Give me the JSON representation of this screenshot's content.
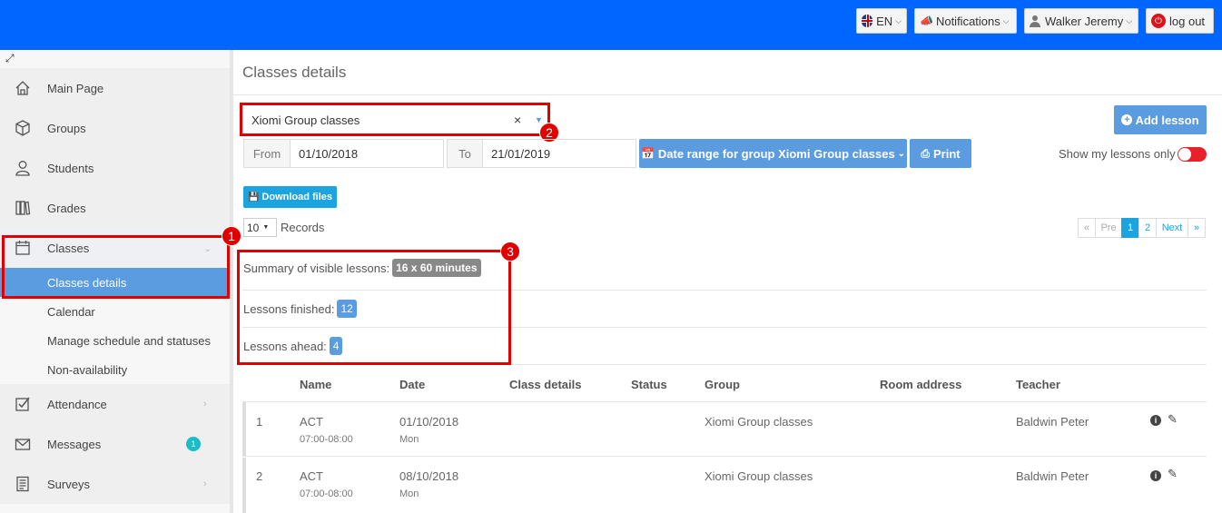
{
  "topbar": {
    "language": "EN",
    "notifications": "Notifications",
    "user": "Walker Jeremy",
    "logout": "log out"
  },
  "sidebar": {
    "items": [
      {
        "label": "Main Page",
        "icon": "home-icon"
      },
      {
        "label": "Groups",
        "icon": "cube-icon"
      },
      {
        "label": "Students",
        "icon": "user-icon"
      },
      {
        "label": "Grades",
        "icon": "book-icon"
      },
      {
        "label": "Classes",
        "icon": "calendar-icon"
      },
      {
        "label": "Attendance",
        "icon": "checkbox-icon"
      },
      {
        "label": "Messages",
        "icon": "envelope-icon",
        "badge": "1"
      },
      {
        "label": "Surveys",
        "icon": "survey-icon"
      }
    ],
    "sub_items": [
      "Classes details",
      "Calendar",
      "Manage schedule and statuses",
      "Non-availability"
    ]
  },
  "annotations": [
    "1",
    "2",
    "3"
  ],
  "main": {
    "title": "Classes details",
    "group_select": {
      "value": "Xiomi Group classes",
      "clear": "×"
    },
    "date_from": {
      "label": "From",
      "value": "01/10/2018"
    },
    "date_to": {
      "label": "To",
      "value": "21/01/2019"
    },
    "date_range_button": "Date range for group Xiomi Group classes",
    "print_button": "Print",
    "add_lesson_button": "Add lesson",
    "show_my_lessons_label": "Show my lessons only",
    "download_button": "Download files",
    "records": {
      "value": "10",
      "label": "Records"
    },
    "pagination": [
      "«",
      "Pre",
      "1",
      "2",
      "Next",
      "»"
    ],
    "summary": {
      "visible_label": "Summary of visible lessons:",
      "visible_value": "16 x 60 minutes",
      "finished_label": "Lessons finished:",
      "finished_value": "12",
      "ahead_label": "Lessons ahead:",
      "ahead_value": "4"
    }
  },
  "table": {
    "headers": [
      "Name",
      "Date",
      "Class details",
      "Status",
      "Group",
      "Room address",
      "Teacher"
    ],
    "rows": [
      {
        "num": "1",
        "name": "ACT",
        "time": "07:00-08:00",
        "date": "01/10/2018",
        "day": "Mon",
        "group": "Xiomi Group classes",
        "teacher": "Baldwin Peter"
      },
      {
        "num": "2",
        "name": "ACT",
        "time": "07:00-08:00",
        "date": "08/10/2018",
        "day": "Mon",
        "group": "Xiomi Group classes",
        "teacher": "Baldwin Peter"
      }
    ]
  },
  "colors": {
    "topbar": "#0066ff",
    "accent": "#5b9bdf",
    "annotation": "#e00000",
    "toggle": "#e8202a"
  }
}
